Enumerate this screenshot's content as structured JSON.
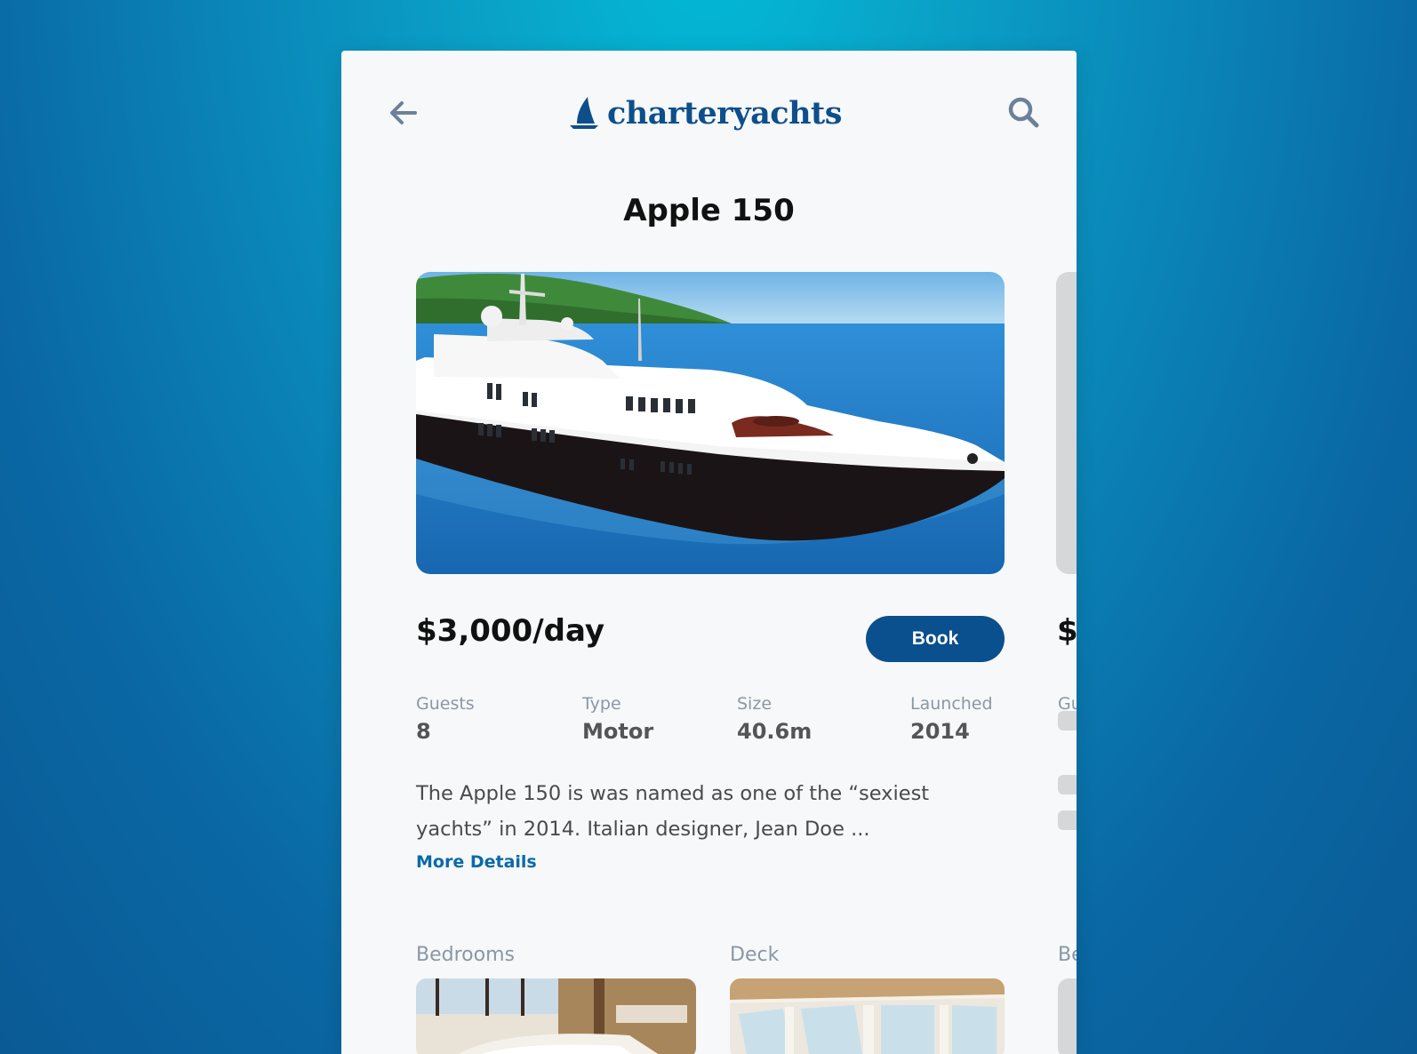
{
  "app": {
    "logo_text": "charteryachts",
    "back_icon": "arrow-left-icon",
    "search_icon": "search-icon",
    "accent_color": "#0a4f8e"
  },
  "yacht": {
    "name": "Apple 150",
    "price": "$3,000/day",
    "book_label": "Book",
    "specs": [
      {
        "label": "Guests",
        "value": "8"
      },
      {
        "label": "Type",
        "value": "Motor"
      },
      {
        "label": "Size",
        "value": "40.6m"
      },
      {
        "label": "Launched",
        "value": "2014"
      }
    ],
    "description": "The Apple 150 is was named as one of the “sexiest yachts” in 2014. Italian designer, Jean Doe ...",
    "more_label": "More Details",
    "gallery": [
      {
        "label": "Bedrooms"
      },
      {
        "label": "Deck"
      }
    ]
  },
  "next_card": {
    "price_partial": "$",
    "spec_label_partial": "Gu",
    "gallery_label_partial": "Be"
  }
}
